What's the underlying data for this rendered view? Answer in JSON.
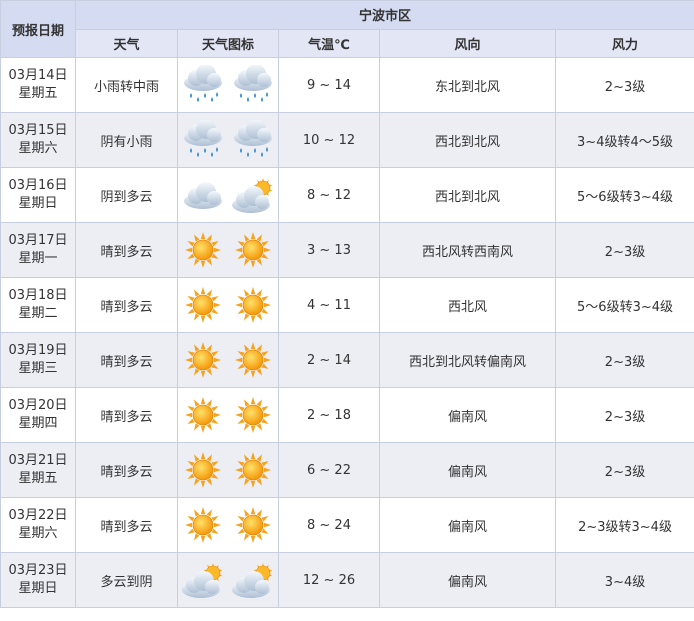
{
  "header": {
    "date_col": "预报日期",
    "city": "宁波市区",
    "weather": "天气",
    "icon": "天气图标",
    "temp": "气温℃",
    "wind_dir": "风向",
    "wind_force": "风力"
  },
  "rows": [
    {
      "date": "03月14日",
      "weekday": "星期五",
      "weather": "小雨转中雨",
      "icons": [
        "rain-cloud-icon",
        "rain-cloud-icon"
      ],
      "temp": "9 ~ 14",
      "wind_dir": "东北到北风",
      "wind_force": "2~3级"
    },
    {
      "date": "03月15日",
      "weekday": "星期六",
      "weather": "阴有小雨",
      "icons": [
        "rain-cloud-icon",
        "rain-cloud-icon"
      ],
      "temp": "10 ~ 12",
      "wind_dir": "西北到北风",
      "wind_force": "3~4级转4～5级"
    },
    {
      "date": "03月16日",
      "weekday": "星期日",
      "weather": "阴到多云",
      "icons": [
        "cloud-icon",
        "partly-cloudy-icon"
      ],
      "temp": "8 ~ 12",
      "wind_dir": "西北到北风",
      "wind_force": "5～6级转3~4级"
    },
    {
      "date": "03月17日",
      "weekday": "星期一",
      "weather": "晴到多云",
      "icons": [
        "sun-icon",
        "sun-icon"
      ],
      "temp": "3 ~ 13",
      "wind_dir": "西北风转西南风",
      "wind_force": "2~3级"
    },
    {
      "date": "03月18日",
      "weekday": "星期二",
      "weather": "晴到多云",
      "icons": [
        "sun-icon",
        "sun-icon"
      ],
      "temp": "4 ~ 11",
      "wind_dir": "西北风",
      "wind_force": "5～6级转3~4级"
    },
    {
      "date": "03月19日",
      "weekday": "星期三",
      "weather": "晴到多云",
      "icons": [
        "sun-icon",
        "sun-icon"
      ],
      "temp": "2 ~ 14",
      "wind_dir": "西北到北风转偏南风",
      "wind_force": "2~3级"
    },
    {
      "date": "03月20日",
      "weekday": "星期四",
      "weather": "晴到多云",
      "icons": [
        "sun-icon",
        "sun-icon"
      ],
      "temp": "2 ~ 18",
      "wind_dir": "偏南风",
      "wind_force": "2~3级"
    },
    {
      "date": "03月21日",
      "weekday": "星期五",
      "weather": "晴到多云",
      "icons": [
        "sun-icon",
        "sun-icon"
      ],
      "temp": "6 ~ 22",
      "wind_dir": "偏南风",
      "wind_force": "2~3级"
    },
    {
      "date": "03月22日",
      "weekday": "星期六",
      "weather": "晴到多云",
      "icons": [
        "sun-icon",
        "sun-icon"
      ],
      "temp": "8 ~ 24",
      "wind_dir": "偏南风",
      "wind_force": "2~3级转3~4级"
    },
    {
      "date": "03月23日",
      "weekday": "星期日",
      "weather": "多云到阴",
      "icons": [
        "partly-cloudy-icon",
        "partly-cloudy-icon"
      ],
      "temp": "12 ~ 26",
      "wind_dir": "偏南风",
      "wind_force": "3~4级"
    }
  ],
  "colors": {
    "header_bg": "#d5dcf2",
    "subheader_bg": "#e3e7f5",
    "alt_row_bg": "#eceef4",
    "border": "#c6cee0",
    "sun": "#f7a21b",
    "cloud": "#c9d6e6",
    "rain": "#3b8fd6"
  }
}
